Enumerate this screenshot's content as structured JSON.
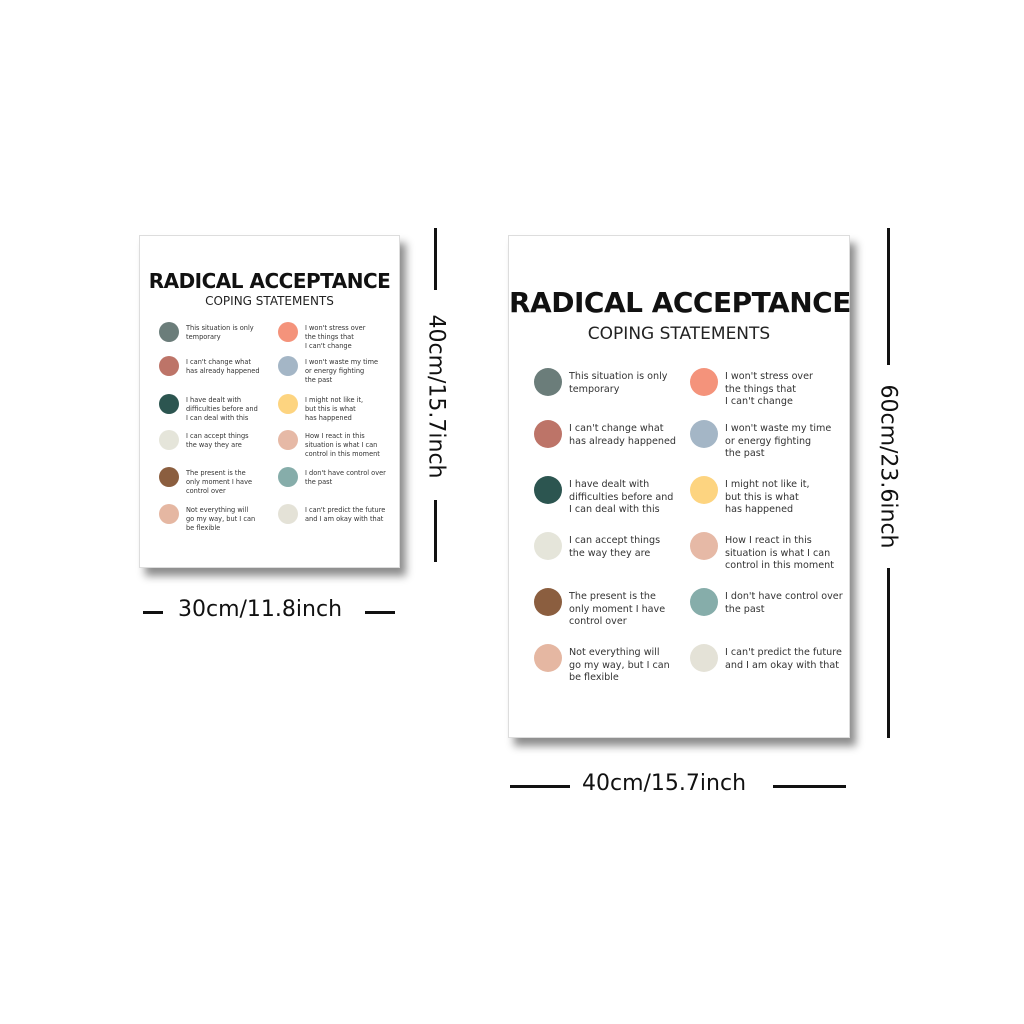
{
  "poster": {
    "title": "RADICAL ACCEPTANCE",
    "subtitle": "COPING STATEMENTS",
    "items": [
      {
        "text": "This situation is only\ntemporary",
        "color": "#6b7d7a"
      },
      {
        "text": "I can't change what\nhas already happened",
        "color": "#bd7468"
      },
      {
        "text": "I have dealt with\ndifficulties before and\nI can deal with this",
        "color": "#2c5550"
      },
      {
        "text": "I can accept things\nthe way they are",
        "color": "#e5e5da"
      },
      {
        "text": "The present is the\nonly moment I have\ncontrol over",
        "color": "#8b5e3f"
      },
      {
        "text": "Not everything will\ngo my way, but I can\nbe flexible",
        "color": "#e5b7a2"
      },
      {
        "text": "I won't stress over\nthe things that\nI can't change",
        "color": "#f4937b"
      },
      {
        "text": "I won't waste my time\nor energy fighting\nthe past",
        "color": "#a4b6c6"
      },
      {
        "text": "I might not like it,\nbut this is what\nhas happened",
        "color": "#fdd480"
      },
      {
        "text": "How I react in this\nsituation is what I can\ncontrol in this moment",
        "color": "#e6b9a6"
      },
      {
        "text": "I don't have control over\nthe past",
        "color": "#86adaa"
      },
      {
        "text": "I can't predict the future\nand I am okay with that",
        "color": "#e4e2d7"
      }
    ]
  },
  "dimensions": {
    "small_width": "30cm/11.8inch",
    "small_height": "40cm/15.7inch",
    "large_width": "40cm/15.7inch",
    "large_height": "60cm/23.6inch"
  }
}
